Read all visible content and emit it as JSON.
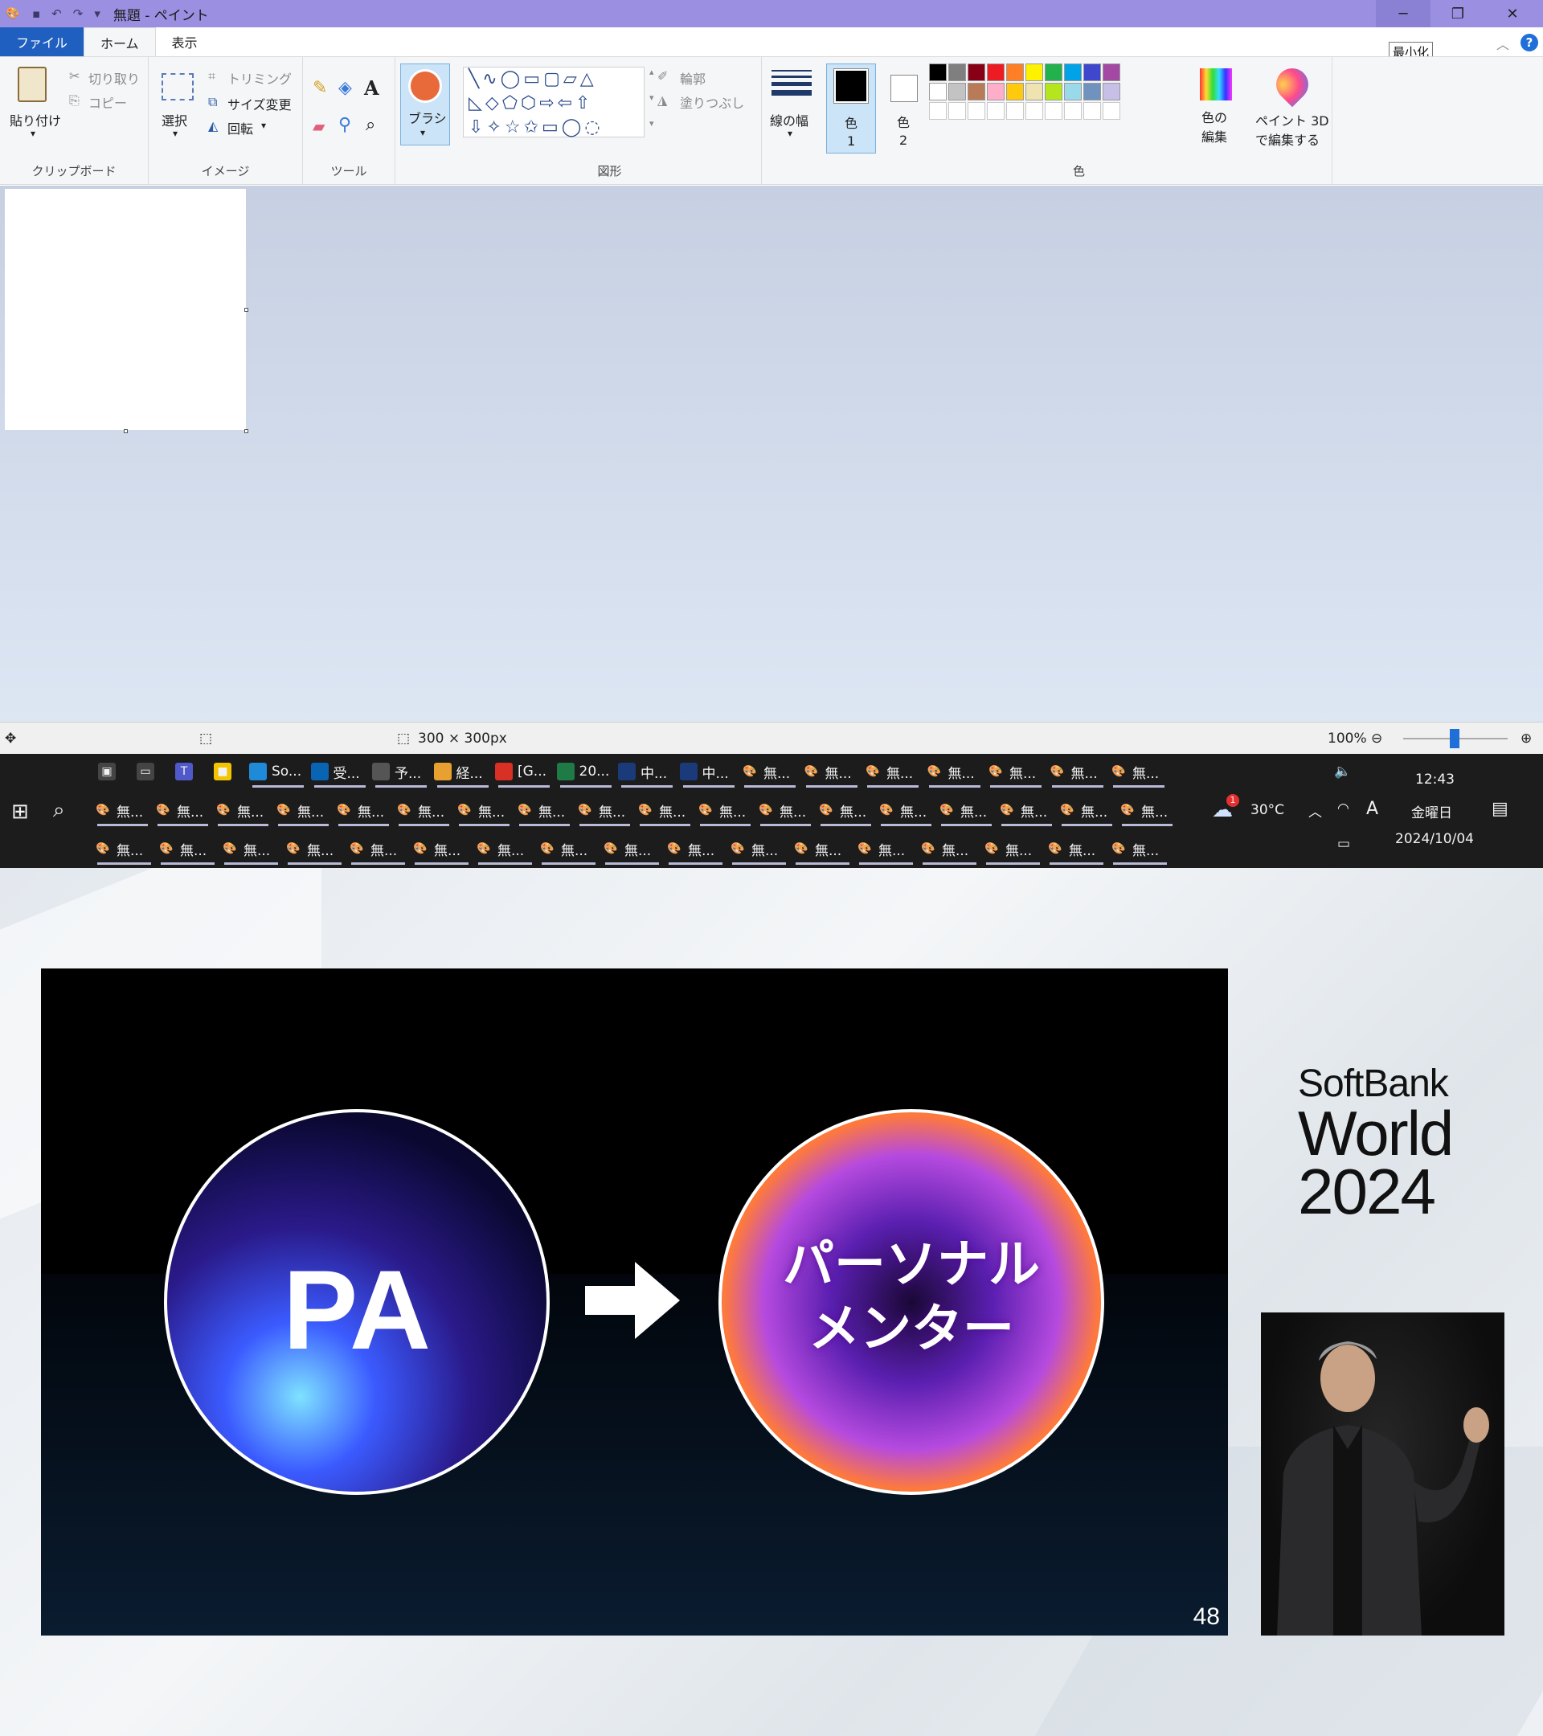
{
  "window": {
    "title": "無題 - ペイント",
    "tooltip": "最小化",
    "help": "?",
    "controls": {
      "minimize": "─",
      "restore": "❐",
      "close": "✕"
    }
  },
  "menu": {
    "tabs": [
      "ファイル",
      "ホーム",
      "表示"
    ]
  },
  "ribbon": {
    "clipboard": {
      "paste": "貼り付け",
      "cut": "切り取り",
      "copy": "コピー",
      "group": "クリップボード"
    },
    "image": {
      "select": "選択",
      "crop": "トリミング",
      "resize": "サイズ変更",
      "rotate": "回転",
      "group": "イメージ"
    },
    "tools": {
      "group": "ツール"
    },
    "brush": {
      "label": "ブラシ"
    },
    "shapes": {
      "outline": "輪郭",
      "fill": "塗りつぶし",
      "group": "図形"
    },
    "line_width": {
      "label": "線の幅"
    },
    "colors": {
      "color1": "色",
      "color1_num": "1",
      "color2": "色",
      "color2_num": "2",
      "edit_line1": "色の",
      "edit_line2": "編集",
      "group": "色",
      "row1": [
        "#000000",
        "#7f7f7f",
        "#880015",
        "#ed1c24",
        "#ff7f27",
        "#fff200",
        "#22b14c",
        "#00a2e8",
        "#3f48cc",
        "#a349a4"
      ],
      "row2": [
        "#ffffff",
        "#c3c3c3",
        "#b97a57",
        "#ffaec9",
        "#ffc90e",
        "#efe4b0",
        "#b5e61d",
        "#99d9ea",
        "#7092be",
        "#c8bfe7"
      ]
    },
    "paint3d": {
      "line1": "ペイント 3D",
      "line2": "で編集する"
    }
  },
  "status": {
    "canvas_size": "300 × 300px",
    "zoom": "100%"
  },
  "taskbar": {
    "row1": [
      "So...",
      "受...",
      "予...",
      "経...",
      "[G...",
      "20...",
      "中...",
      "中...",
      "無...",
      "無...",
      "無...",
      "無...",
      "無...",
      "無...",
      "無..."
    ],
    "row2_label": "無...",
    "row3_label": "無...",
    "weather": "30°C",
    "weather_badge": "1",
    "time": "12:43",
    "day": "金曜日",
    "date": "2024/10/04",
    "ime": "A"
  },
  "slide": {
    "left_text": "PA",
    "right_line1": "パーソナル",
    "right_line2": "メンター",
    "number": "48"
  },
  "logo": {
    "line1": "SoftBank",
    "line2": "World",
    "line3": "2024"
  }
}
